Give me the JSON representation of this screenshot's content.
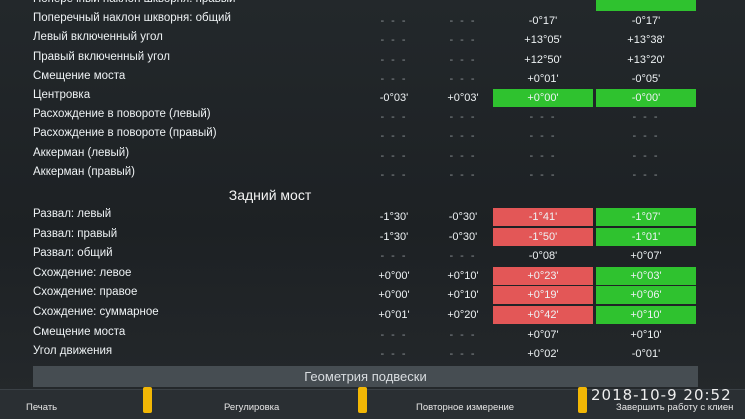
{
  "front_rows": [
    {
      "label": "Поперечный наклон шкворня: правый",
      "v1": "",
      "v2": "",
      "v3": "",
      "v4": ""
    },
    {
      "label": "Поперечный наклон шкворня: общий",
      "v1": "- - -",
      "v2": "- - -",
      "v3": "-0°17'",
      "v4": "-0°17'"
    },
    {
      "label": "Левый включенный угол",
      "v1": "- - -",
      "v2": "- - -",
      "v3": "+13°05'",
      "v4": "+13°38'"
    },
    {
      "label": "Правый включенный угол",
      "v1": "- - -",
      "v2": "- - -",
      "v3": "+12°50'",
      "v4": "+13°20'"
    },
    {
      "label": "Смещение моста",
      "v1": "- - -",
      "v2": "- - -",
      "v3": "+0°01'",
      "v4": "-0°05'"
    },
    {
      "label": "Центровка",
      "v1": "-0°03'",
      "v2": "+0°03'",
      "v3": "+0°00'",
      "v4": "-0°00'"
    },
    {
      "label": "Расхождение в повороте (левый)",
      "v1": "- - -",
      "v2": "- - -",
      "v3": "- - -",
      "v4": "- - -"
    },
    {
      "label": "Расхождение в повороте (правый)",
      "v1": "- - -",
      "v2": "- - -",
      "v3": "- - -",
      "v4": "- - -"
    },
    {
      "label": "Аккерман (левый)",
      "v1": "- - -",
      "v2": "- - -",
      "v3": "- - -",
      "v4": "- - -"
    },
    {
      "label": "Аккерман (правый)",
      "v1": "- - -",
      "v2": "- - -",
      "v3": "- - -",
      "v4": "- - -"
    }
  ],
  "rear_title": "Задний мост",
  "rear_rows": [
    {
      "label": "Развал: левый",
      "v1": "-1°30'",
      "v2": "-0°30'",
      "v3": "-1°41'",
      "v4": "-1°07'"
    },
    {
      "label": "Развал: правый",
      "v1": "-1°30'",
      "v2": "-0°30'",
      "v3": "-1°50'",
      "v4": "-1°01'"
    },
    {
      "label": "Развал: общий",
      "v1": "- - -",
      "v2": "- - -",
      "v3": "-0°08'",
      "v4": "+0°07'"
    },
    {
      "label": "Схождение: левое",
      "v1": "+0°00'",
      "v2": "+0°10'",
      "v3": "+0°23'",
      "v4": "+0°03'"
    },
    {
      "label": "Схождение: правое",
      "v1": "+0°00'",
      "v2": "+0°10'",
      "v3": "+0°19'",
      "v4": "+0°06'"
    },
    {
      "label": "Схождение: суммарное",
      "v1": "+0°01'",
      "v2": "+0°20'",
      "v3": "+0°42'",
      "v4": "+0°10'"
    },
    {
      "label": "Смещение моста",
      "v1": "- - -",
      "v2": "- - -",
      "v3": "+0°07'",
      "v4": "+0°10'"
    },
    {
      "label": "Угол движения",
      "v1": "- - -",
      "v2": "- - -",
      "v3": "+0°02'",
      "v4": "-0°01'"
    }
  ],
  "status_colors": {
    "out_of_range": "#e35757",
    "in_range": "#2fc22f"
  },
  "bottom_bar": {
    "title": "Геометрия подвески",
    "print": "Печать",
    "adjust": "Регулировка",
    "remeasure": "Повторное измерение",
    "finish": "Завершить работу с клиен"
  },
  "timestamp": "2018-10-9 20:52"
}
